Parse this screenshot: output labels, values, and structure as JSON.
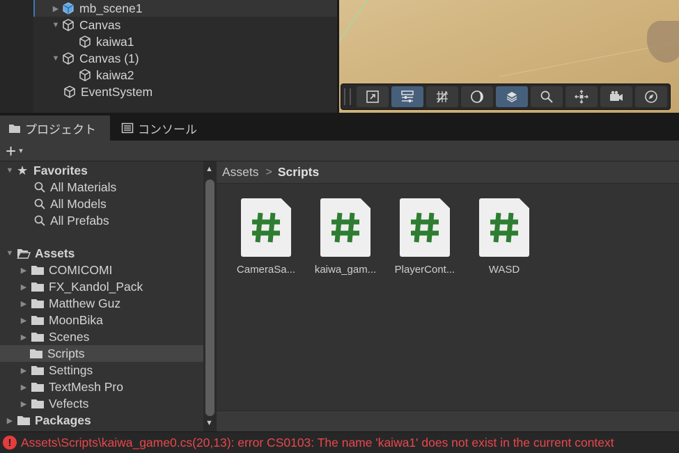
{
  "hierarchy": {
    "items": [
      {
        "label": "mb_scene1",
        "icon": "prefab-cube-icon",
        "expanded": false
      },
      {
        "label": "Canvas",
        "icon": "gameobject-cube-icon",
        "expanded": true
      },
      {
        "label": "kaiwa1",
        "icon": "gameobject-cube-icon"
      },
      {
        "label": "Canvas (1)",
        "icon": "gameobject-cube-icon",
        "expanded": true
      },
      {
        "label": "kaiwa2",
        "icon": "gameobject-cube-icon"
      },
      {
        "label": "EventSystem",
        "icon": "gameobject-cube-icon"
      }
    ]
  },
  "scene_toolbar": {
    "buttons": [
      {
        "icon": "maximize-icon",
        "active": false
      },
      {
        "icon": "overlay-settings-icon",
        "active": true
      },
      {
        "icon": "grid-snap-icon",
        "active": false
      },
      {
        "icon": "shading-mode-icon",
        "active": false
      },
      {
        "icon": "layers-icon",
        "active": true
      },
      {
        "icon": "search-icon",
        "active": false
      },
      {
        "icon": "move-tool-icon",
        "active": false
      },
      {
        "icon": "camera-icon",
        "active": false
      },
      {
        "icon": "gizmos-icon",
        "active": false
      }
    ]
  },
  "tabs": [
    {
      "label": "プロジェクト",
      "icon": "folder-icon",
      "active": true
    },
    {
      "label": "コンソール",
      "icon": "console-icon",
      "active": false
    }
  ],
  "toolbar": {
    "add_symbol": "+",
    "dropdown_symbol": "▾"
  },
  "tree": {
    "favorites": {
      "label": "Favorites",
      "items": [
        "All Materials",
        "All Models",
        "All Prefabs"
      ]
    },
    "assets": {
      "label": "Assets",
      "folders": [
        "COMICOMI",
        "FX_Kandol_Pack",
        "Matthew Guz",
        "MoonBika",
        "Scenes",
        "Scripts",
        "Settings",
        "TextMesh Pro",
        "Vefects"
      ],
      "selected": "Scripts"
    },
    "packages": {
      "label": "Packages"
    }
  },
  "breadcrumb": {
    "root": "Assets",
    "separator": ">",
    "current": "Scripts"
  },
  "assets": [
    {
      "name": "CameraSa...",
      "icon": "csharp-script-icon"
    },
    {
      "name": "kaiwa_gam...",
      "icon": "csharp-script-icon"
    },
    {
      "name": "PlayerCont...",
      "icon": "csharp-script-icon"
    },
    {
      "name": "WASD",
      "icon": "csharp-script-icon"
    }
  ],
  "status": {
    "icon": "error-icon",
    "message": "Assets\\Scripts\\kaiwa_game0.cs(20,13): error CS0103: The name 'kaiwa1' does not exist in the current context",
    "color": "#e8474c"
  },
  "colors": {
    "selection_accent": "#3a79bb",
    "active_toggle": "#46607c",
    "script_hash": "#2e7d32",
    "error": "#e8474c"
  }
}
